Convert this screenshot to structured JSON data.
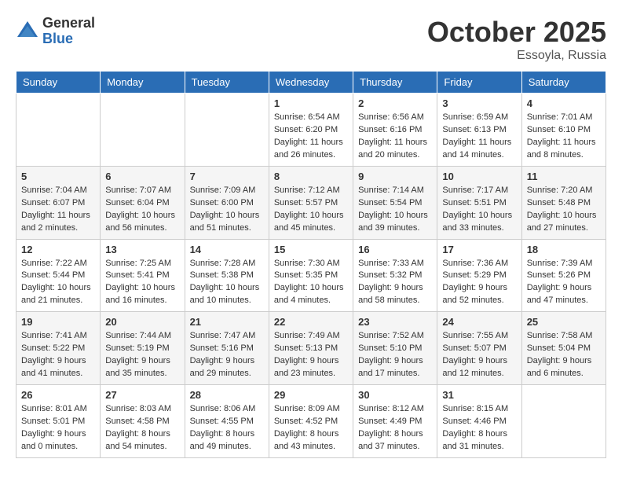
{
  "logo": {
    "text_general": "General",
    "text_blue": "Blue"
  },
  "header": {
    "month_year": "October 2025",
    "location": "Essoyla, Russia"
  },
  "weekdays": [
    "Sunday",
    "Monday",
    "Tuesday",
    "Wednesday",
    "Thursday",
    "Friday",
    "Saturday"
  ],
  "weeks": [
    [
      {
        "day": "",
        "info": ""
      },
      {
        "day": "",
        "info": ""
      },
      {
        "day": "",
        "info": ""
      },
      {
        "day": "1",
        "info": "Sunrise: 6:54 AM\nSunset: 6:20 PM\nDaylight: 11 hours\nand 26 minutes."
      },
      {
        "day": "2",
        "info": "Sunrise: 6:56 AM\nSunset: 6:16 PM\nDaylight: 11 hours\nand 20 minutes."
      },
      {
        "day": "3",
        "info": "Sunrise: 6:59 AM\nSunset: 6:13 PM\nDaylight: 11 hours\nand 14 minutes."
      },
      {
        "day": "4",
        "info": "Sunrise: 7:01 AM\nSunset: 6:10 PM\nDaylight: 11 hours\nand 8 minutes."
      }
    ],
    [
      {
        "day": "5",
        "info": "Sunrise: 7:04 AM\nSunset: 6:07 PM\nDaylight: 11 hours\nand 2 minutes."
      },
      {
        "day": "6",
        "info": "Sunrise: 7:07 AM\nSunset: 6:04 PM\nDaylight: 10 hours\nand 56 minutes."
      },
      {
        "day": "7",
        "info": "Sunrise: 7:09 AM\nSunset: 6:00 PM\nDaylight: 10 hours\nand 51 minutes."
      },
      {
        "day": "8",
        "info": "Sunrise: 7:12 AM\nSunset: 5:57 PM\nDaylight: 10 hours\nand 45 minutes."
      },
      {
        "day": "9",
        "info": "Sunrise: 7:14 AM\nSunset: 5:54 PM\nDaylight: 10 hours\nand 39 minutes."
      },
      {
        "day": "10",
        "info": "Sunrise: 7:17 AM\nSunset: 5:51 PM\nDaylight: 10 hours\nand 33 minutes."
      },
      {
        "day": "11",
        "info": "Sunrise: 7:20 AM\nSunset: 5:48 PM\nDaylight: 10 hours\nand 27 minutes."
      }
    ],
    [
      {
        "day": "12",
        "info": "Sunrise: 7:22 AM\nSunset: 5:44 PM\nDaylight: 10 hours\nand 21 minutes."
      },
      {
        "day": "13",
        "info": "Sunrise: 7:25 AM\nSunset: 5:41 PM\nDaylight: 10 hours\nand 16 minutes."
      },
      {
        "day": "14",
        "info": "Sunrise: 7:28 AM\nSunset: 5:38 PM\nDaylight: 10 hours\nand 10 minutes."
      },
      {
        "day": "15",
        "info": "Sunrise: 7:30 AM\nSunset: 5:35 PM\nDaylight: 10 hours\nand 4 minutes."
      },
      {
        "day": "16",
        "info": "Sunrise: 7:33 AM\nSunset: 5:32 PM\nDaylight: 9 hours\nand 58 minutes."
      },
      {
        "day": "17",
        "info": "Sunrise: 7:36 AM\nSunset: 5:29 PM\nDaylight: 9 hours\nand 52 minutes."
      },
      {
        "day": "18",
        "info": "Sunrise: 7:39 AM\nSunset: 5:26 PM\nDaylight: 9 hours\nand 47 minutes."
      }
    ],
    [
      {
        "day": "19",
        "info": "Sunrise: 7:41 AM\nSunset: 5:22 PM\nDaylight: 9 hours\nand 41 minutes."
      },
      {
        "day": "20",
        "info": "Sunrise: 7:44 AM\nSunset: 5:19 PM\nDaylight: 9 hours\nand 35 minutes."
      },
      {
        "day": "21",
        "info": "Sunrise: 7:47 AM\nSunset: 5:16 PM\nDaylight: 9 hours\nand 29 minutes."
      },
      {
        "day": "22",
        "info": "Sunrise: 7:49 AM\nSunset: 5:13 PM\nDaylight: 9 hours\nand 23 minutes."
      },
      {
        "day": "23",
        "info": "Sunrise: 7:52 AM\nSunset: 5:10 PM\nDaylight: 9 hours\nand 17 minutes."
      },
      {
        "day": "24",
        "info": "Sunrise: 7:55 AM\nSunset: 5:07 PM\nDaylight: 9 hours\nand 12 minutes."
      },
      {
        "day": "25",
        "info": "Sunrise: 7:58 AM\nSunset: 5:04 PM\nDaylight: 9 hours\nand 6 minutes."
      }
    ],
    [
      {
        "day": "26",
        "info": "Sunrise: 8:01 AM\nSunset: 5:01 PM\nDaylight: 9 hours\nand 0 minutes."
      },
      {
        "day": "27",
        "info": "Sunrise: 8:03 AM\nSunset: 4:58 PM\nDaylight: 8 hours\nand 54 minutes."
      },
      {
        "day": "28",
        "info": "Sunrise: 8:06 AM\nSunset: 4:55 PM\nDaylight: 8 hours\nand 49 minutes."
      },
      {
        "day": "29",
        "info": "Sunrise: 8:09 AM\nSunset: 4:52 PM\nDaylight: 8 hours\nand 43 minutes."
      },
      {
        "day": "30",
        "info": "Sunrise: 8:12 AM\nSunset: 4:49 PM\nDaylight: 8 hours\nand 37 minutes."
      },
      {
        "day": "31",
        "info": "Sunrise: 8:15 AM\nSunset: 4:46 PM\nDaylight: 8 hours\nand 31 minutes."
      },
      {
        "day": "",
        "info": ""
      }
    ]
  ]
}
